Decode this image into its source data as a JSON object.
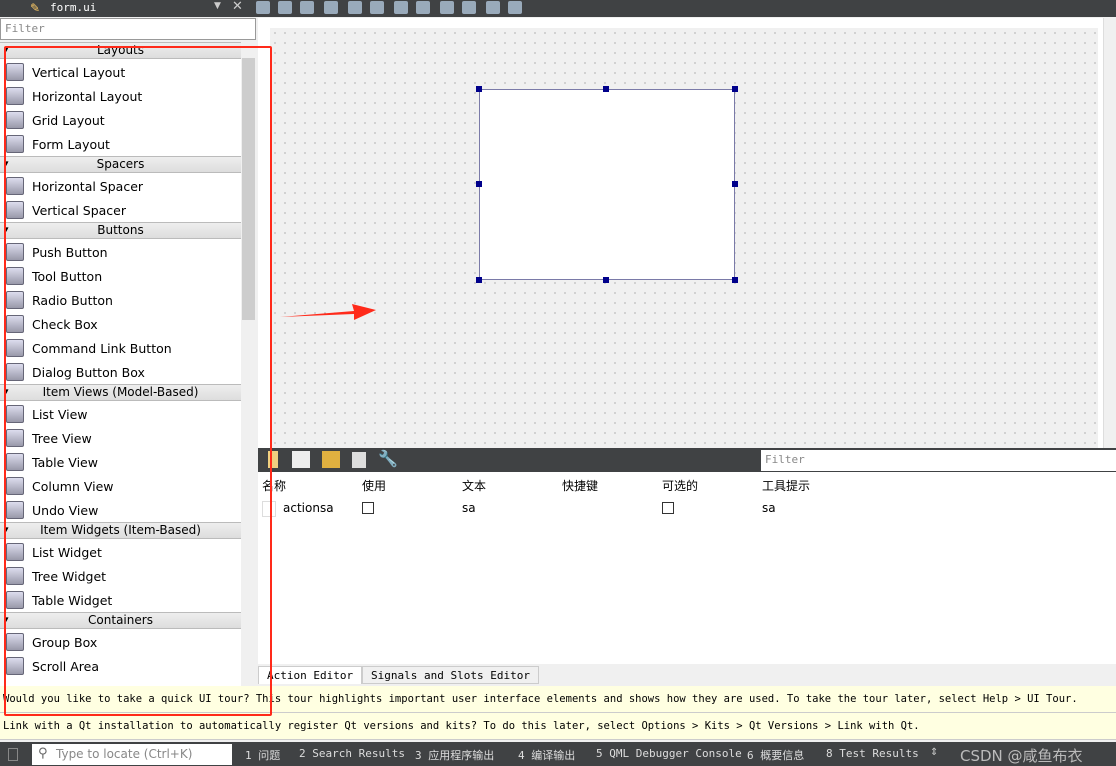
{
  "editor": {
    "doc_name": "form.ui",
    "filter_placeholder": "Filter"
  },
  "widget_box": {
    "categories": [
      {
        "name": "Layouts",
        "items": [
          "Vertical Layout",
          "Horizontal Layout",
          "Grid Layout",
          "Form Layout"
        ]
      },
      {
        "name": "Spacers",
        "items": [
          "Horizontal Spacer",
          "Vertical Spacer"
        ]
      },
      {
        "name": "Buttons",
        "items": [
          "Push Button",
          "Tool Button",
          "Radio Button",
          "Check Box",
          "Command Link Button",
          "Dialog Button Box"
        ]
      },
      {
        "name": "Item Views (Model-Based)",
        "items": [
          "List View",
          "Tree View",
          "Table View",
          "Column View",
          "Undo View"
        ]
      },
      {
        "name": "Item Widgets (Item-Based)",
        "items": [
          "List Widget",
          "Tree Widget",
          "Table Widget"
        ]
      },
      {
        "name": "Containers",
        "items": [
          "Group Box",
          "Scroll Area"
        ]
      }
    ]
  },
  "action_editor": {
    "filter_placeholder": "Filter",
    "columns": [
      "名称",
      "使用",
      "文本",
      "快捷键",
      "可选的",
      "工具提示"
    ],
    "rows": [
      {
        "name": "actionsa",
        "used": false,
        "text": "sa",
        "shortcut": "",
        "checkable": false,
        "tooltip": "sa"
      }
    ]
  },
  "tabs": [
    "Action Editor",
    "Signals and Slots Editor"
  ],
  "info_bars": [
    "Would you like to take a quick UI tour? This tour highlights important user interface elements and shows how they are used. To take the tour later, select Help > UI Tour.",
    "Link with a Qt installation to automatically register Qt versions and kits? To do this later, select Options > Kits > Qt Versions > Link with Qt."
  ],
  "status": {
    "locate_placeholder": "Type to locate (Ctrl+K)",
    "panes": [
      "1 问题",
      "2 Search Results",
      "3 应用程序输出",
      "4 编译输出",
      "5 QML Debugger Console",
      "6 概要信息",
      "8 Test Results"
    ],
    "watermark": "CSDN @咸鱼布衣"
  },
  "colors": {
    "annotation": "#ff2a1a",
    "dark_bar": "#404244",
    "info_bg": "#ffffe1"
  }
}
